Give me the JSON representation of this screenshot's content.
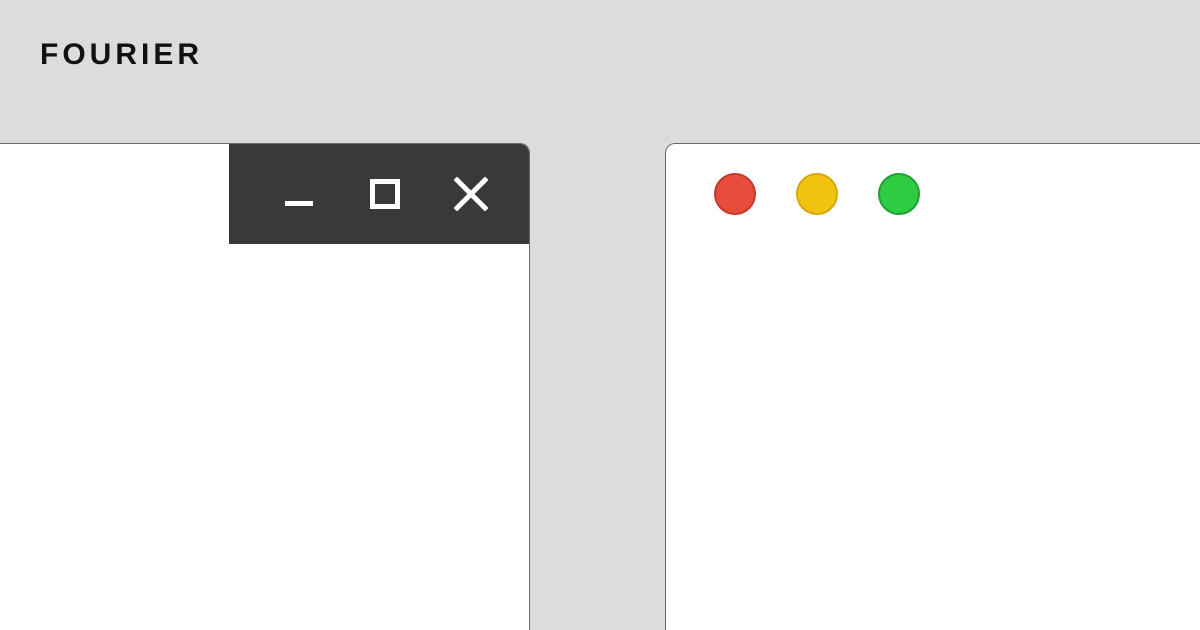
{
  "brand": "FOURIER",
  "colors": {
    "accent_red": "#e74c4c",
    "windows_titlebar": "#393939",
    "page_bg": "#dcdcdc",
    "mac_close": "#E74C3C",
    "mac_minimize": "#F1C40F",
    "mac_zoom": "#2ECC40"
  },
  "windows_controls": {
    "minimize": "minimize",
    "maximize": "maximize",
    "close": "close"
  },
  "mac_controls": {
    "close": "close",
    "minimize": "minimize",
    "zoom": "zoom"
  }
}
